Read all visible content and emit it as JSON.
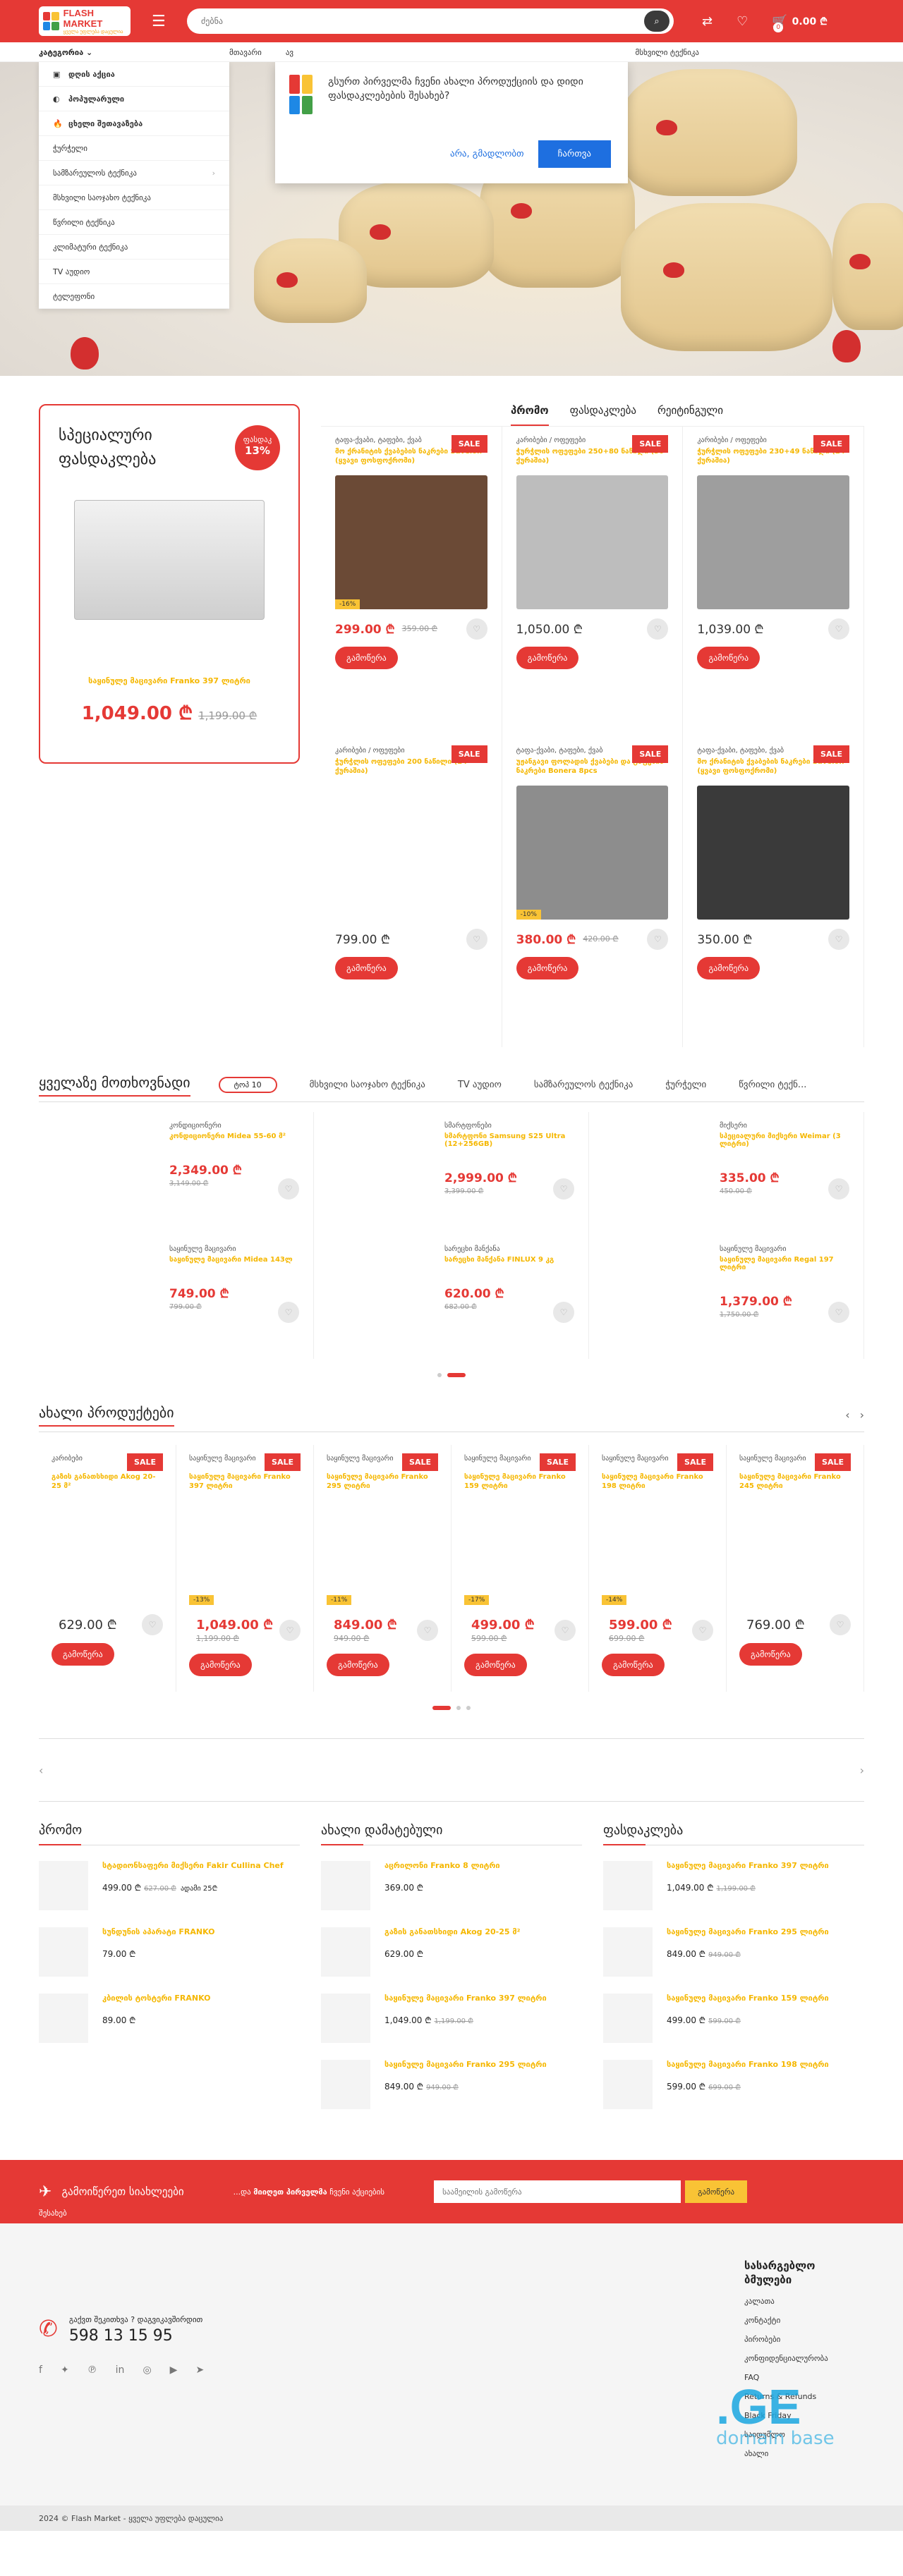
{
  "header": {
    "logo_line1": "FLASH MARKET",
    "logo_line2": "ყველა უფლება დაცულია",
    "search_placeholder": "ძებნა",
    "cart_count": "0",
    "cart_total": "0.00 ₾"
  },
  "nav": {
    "categories_label": "კატეგორია",
    "links": [
      "მთავარი",
      "ავ"
    ],
    "right_link": "მსხვილი ტექნიკა"
  },
  "category_menu": [
    {
      "label": "დღის აქცია",
      "icon": "▣",
      "bold": true
    },
    {
      "label": "პოპულარული",
      "icon": "◐",
      "bold": true
    },
    {
      "label": "ცხელი შეთავაზება",
      "icon": "🔥",
      "bold": true
    },
    {
      "label": "ჭურჭელი"
    },
    {
      "label": "სამზარეულოს ტექნიკა",
      "arrow": true
    },
    {
      "label": "მსხვილი საოჯახო ტექნიკა"
    },
    {
      "label": "წვრილი ტექნიკა"
    },
    {
      "label": "კლიმატური ტექნიკა"
    },
    {
      "label": "TV აუდიო"
    },
    {
      "label": "ტელეფონი"
    }
  ],
  "popup": {
    "text": "გსურთ პირველმა ჩვენი ახალი პროდუქციის და დიდი ფასდაკლებების შესახებ?",
    "no": "არა, გმადლობთ",
    "yes": "ჩართვა"
  },
  "special": {
    "title": "სპეციალური ფასდაკლება",
    "badge_label": "ფასდაკ",
    "badge_pct": "13%",
    "product": "საყინულე მაცივარი Franko 397 ლიტრი",
    "price": "1,049.00 ₾",
    "old_price": "1,199.00 ₾"
  },
  "tabs": [
    "პრომო",
    "ფასდაკლება",
    "რეიტინგული"
  ],
  "promo_products": [
    {
      "cat": "ტაფა-ქვაბი, ტაფები, ქვაბ",
      "title": "მო ქრანიტის ქვაბების ნაკრები Savelon (ყვავი ფოსფოქრომი)",
      "price": "299.00 ₾",
      "old": "359.00 ₾",
      "pct": "-16%",
      "sale": "SALE",
      "img": "#6b4a36",
      "buy": "გამოწერა"
    },
    {
      "cat": "კარიბები / ოფეფები",
      "title": "ჭურჭლის ოფეფები 250+80 ნაწილი (30 ქურაშია)",
      "price": "1,050.00 ₾",
      "old": "",
      "pct": "",
      "sale": "SALE",
      "img": "#bdbdbd",
      "buy": "გამოწერა"
    },
    {
      "cat": "კარიბები / ოფეფები",
      "title": "ჭურჭლის ოფეფები 230+49 ნაწილი (24 ქურაშია)",
      "price": "1,039.00 ₾",
      "old": "",
      "pct": "",
      "sale": "SALE",
      "img": "#9e9e9e",
      "buy": "გამოწერა"
    },
    {
      "cat": "კარიბები / ოფეფები",
      "title": "ჭურჭლის ოფეფები 200 ნაწილი (24 ქურაშია)",
      "price": "799.00 ₾",
      "old": "",
      "pct": "",
      "sale": "SALE",
      "img": "#ffffff",
      "buy": "გამოწერა"
    },
    {
      "cat": "ტაფა-ქვაბი, ტაფები, ქვაბ",
      "title": "უჟანგავი ფოლადის ქვაბები და ტაფების ნაკრები Bonera 8pcs",
      "price": "380.00 ₾",
      "old": "420.00 ₾",
      "pct": "-10%",
      "sale": "SALE",
      "img": "#8d8d8d",
      "buy": "გამოწერა"
    },
    {
      "cat": "ტაფა-ქვაბი, ტაფები, ქვაბ",
      "title": "მო ქრანიტის ქვაბების ნაკრები Savelon (ყვავი ფოსფოქრომი)",
      "price": "350.00 ₾",
      "old": "",
      "pct": "",
      "sale": "SALE",
      "img": "#3a3a3a",
      "buy": "გამოწერა"
    }
  ],
  "bestsellers": {
    "title": "ყველაზე მოთხოვნადი",
    "chip": "ტოპ 10",
    "tabs": [
      "მსხვილი საოჯახო ტექნიკა",
      "TV აუდიო",
      "სამზარეულოს ტექნიკა",
      "ჭურჭელი",
      "წვრილი ტექნ..."
    ],
    "items": [
      {
        "cat": "კონდიციონერი",
        "title": "კონდიციონერი Midea 55-60 მ²",
        "price": "2,349.00 ₾",
        "old": "3,149.00 ₾"
      },
      {
        "cat": "სმარტფონები",
        "title": "სმარტფონი Samsung S25 Ultra (12+256GB)",
        "price": "2,999.00 ₾",
        "old": "3,399.00 ₾"
      },
      {
        "cat": "მიქსერი",
        "title": "სპეციალური მიქსერი Weimar (3 ლიტრი)",
        "price": "335.00 ₾",
        "old": "450.00 ₾"
      },
      {
        "cat": "საყინულე მაცივარი",
        "title": "საყინულე მაცივარი Midea 143ლ",
        "price": "749.00 ₾",
        "old": "799.00 ₾"
      },
      {
        "cat": "სარეცხი მანქანა",
        "title": "სარეცხი მანქანა FINLUX 9 კგ",
        "price": "620.00 ₾",
        "old": "682.00 ₾"
      },
      {
        "cat": "საყინულე მაცივარი",
        "title": "საყინულე მაცივარი Regal 197 ლიტრი",
        "price": "1,379.00 ₾",
        "old": "1,750.00 ₾"
      }
    ]
  },
  "new_products": {
    "title": "ახალი პროდუქტები",
    "items": [
      {
        "cat": "კარიბები",
        "title": "გაზის განათსხიდი Akog 20-25 მ²",
        "price": "629.00 ₾",
        "old": "",
        "pct": "",
        "sale": "SALE"
      },
      {
        "cat": "საყინულე მაცივარი",
        "title": "საყინულე მაცივარი Franko 397 ლიტრი",
        "price": "1,049.00 ₾",
        "old": "1,199.00 ₾",
        "pct": "-13%",
        "sale": "SALE"
      },
      {
        "cat": "საყინულე მაცივარი",
        "title": "საყინულე მაცივარი Franko 295 ლიტრი",
        "price": "849.00 ₾",
        "old": "949.00 ₾",
        "pct": "-11%",
        "sale": "SALE"
      },
      {
        "cat": "საყინულე მაცივარი",
        "title": "საყინულე მაცივარი Franko 159 ლიტრი",
        "price": "499.00 ₾",
        "old": "599.00 ₾",
        "pct": "-17%",
        "sale": "SALE"
      },
      {
        "cat": "საყინულე მაცივარი",
        "title": "საყინულე მაცივარი Franko 198 ლიტრი",
        "price": "599.00 ₾",
        "old": "699.00 ₾",
        "pct": "-14%",
        "sale": "SALE"
      },
      {
        "cat": "საყინულე მაცივარი",
        "title": "საყინულე მაცივარი Franko 245 ლიტრი",
        "price": "769.00 ₾",
        "old": "",
        "pct": "",
        "sale": "SALE"
      }
    ],
    "buy": "გამოწერა"
  },
  "lists": [
    {
      "title": "პრომო",
      "items": [
        {
          "t": "სტადიონსაფერი მიქსერი Fakir Cullina Chef",
          "p": "499.00 ₾",
          "o": "627.00 ₾",
          "x": "ადამი 25₾"
        },
        {
          "t": "სუნდუნის აპარატი FRANKO",
          "p": "79.00 ₾",
          "o": "",
          "x": ""
        },
        {
          "t": "კბილის ტოსტერი FRANKO",
          "p": "89.00 ₾",
          "o": "",
          "x": ""
        }
      ]
    },
    {
      "title": "ახალი დამატებული",
      "items": [
        {
          "t": "აცრილონი Franko 8 ლიტრი",
          "p": "369.00 ₾",
          "o": "",
          "x": ""
        },
        {
          "t": "გაზის განათსხიდი Akog 20-25 მ²",
          "p": "629.00 ₾",
          "o": "",
          "x": ""
        },
        {
          "t": "საყინულე მაცივარი Franko 397 ლიტრი",
          "p": "1,049.00 ₾",
          "o": "1,199.00 ₾",
          "x": ""
        },
        {
          "t": "საყინულე მაცივარი Franko 295 ლიტრი",
          "p": "849.00 ₾",
          "o": "949.00 ₾",
          "x": ""
        }
      ]
    },
    {
      "title": "ფასდაკლება",
      "items": [
        {
          "t": "საყინულე მაცივარი Franko 397 ლიტრი",
          "p": "1,049.00 ₾",
          "o": "1,199.00 ₾",
          "x": ""
        },
        {
          "t": "საყინულე მაცივარი Franko 295 ლიტრი",
          "p": "849.00 ₾",
          "o": "949.00 ₾",
          "x": ""
        },
        {
          "t": "საყინულე მაცივარი Franko 159 ლიტრი",
          "p": "499.00 ₾",
          "o": "599.00 ₾",
          "x": ""
        },
        {
          "t": "საყინულე მაცივარი Franko 198 ლიტრი",
          "p": "599.00 ₾",
          "o": "699.00 ₾",
          "x": ""
        }
      ]
    }
  ],
  "newsletter": {
    "title": "გამოიწერეთ სიახლეები",
    "desc_pre": "...და ",
    "desc_bold": "მიიღეთ პირველმა",
    "desc_post": " ჩვენი აქციების",
    "sub": "შესახებ",
    "placeholder": "საამეილის გამოწერა",
    "button": "გამოწერა"
  },
  "footer": {
    "question": "გაქვთ შეკითხვა ? დაგვიკავშირდით",
    "phone": "598 13 15 95",
    "col_title": "სასარგებლო ბმულები",
    "links": [
      "კალათა",
      "კონტაქტი",
      "პირობები",
      "კონფიდენციალურობა",
      "FAQ",
      "Returns & Refunds",
      "Black Friday",
      "საიდუმლო",
      "ახალი"
    ],
    "domain_big": ".GE",
    "domain_small": "domain base",
    "copyright": "2024 © Flash Market - ყველა უფლება დაცულია"
  }
}
